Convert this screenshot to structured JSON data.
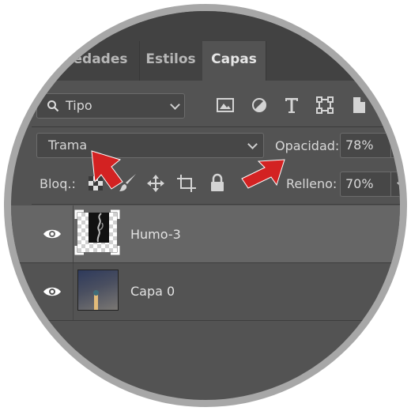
{
  "tabs": [
    {
      "label": "piedades",
      "active": false
    },
    {
      "label": "Estilos",
      "active": false
    },
    {
      "label": "Capas",
      "active": true
    }
  ],
  "filter": {
    "kind_label": "Tipo",
    "icons": [
      "image-filter-icon",
      "adjustment-filter-icon",
      "type-filter-icon",
      "shape-filter-icon",
      "smart-object-filter-icon"
    ]
  },
  "blend": {
    "mode": "Trama",
    "opacity_label": "Opacidad:",
    "opacity_value": "78%"
  },
  "lock": {
    "label": "Bloq.:",
    "icons": [
      "lock-transparent-pixels-icon",
      "lock-image-pixels-icon",
      "lock-position-icon",
      "lock-artboard-icon",
      "lock-all-icon"
    ],
    "fill_label": "Relleno:",
    "fill_value": "70%"
  },
  "layers": [
    {
      "name": "Humo-3",
      "visible": true,
      "selected": true
    },
    {
      "name": "Capa 0",
      "visible": true,
      "selected": false
    }
  ],
  "colors": {
    "panel_bg": "#535353",
    "tabbar_bg": "#424242",
    "selected_row": "#666666",
    "annotation_arrow": "#d32222"
  }
}
